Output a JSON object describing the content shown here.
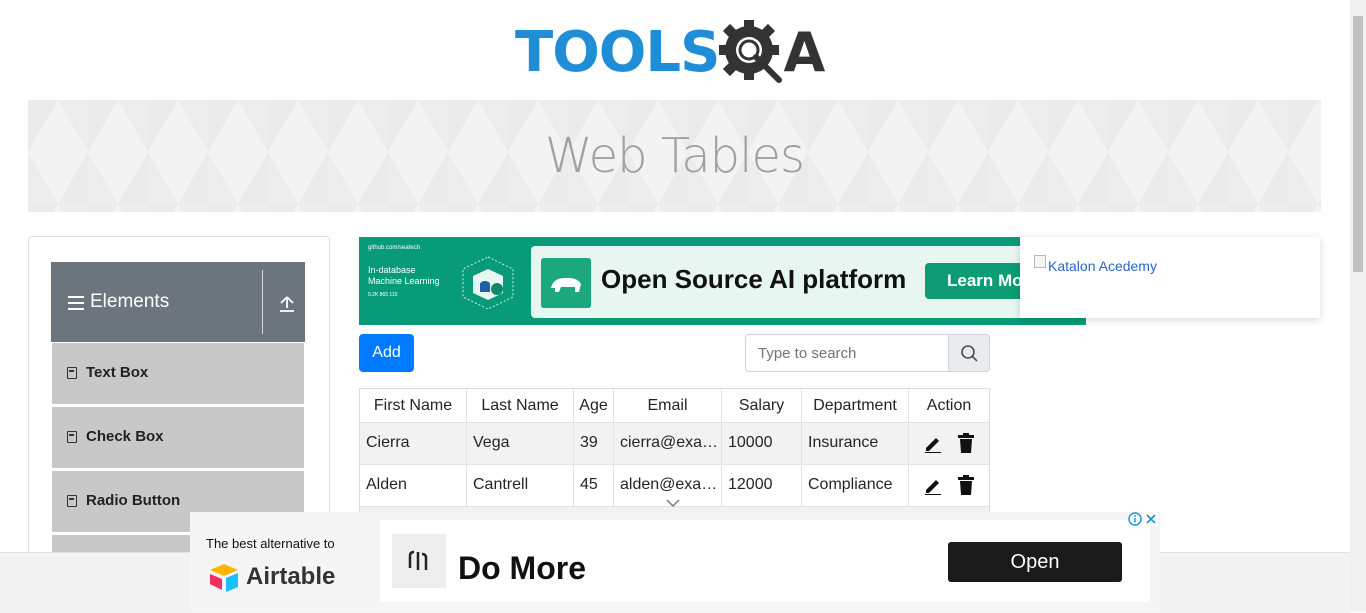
{
  "logo": {
    "tools": "TOOLS",
    "a": "A"
  },
  "banner": {
    "title": "Web Tables"
  },
  "sidebar": {
    "group_title": "Elements",
    "items": [
      {
        "label": "Text Box"
      },
      {
        "label": "Check Box"
      },
      {
        "label": "Radio Button"
      }
    ]
  },
  "ad_top": {
    "small": "github.com/seatech",
    "line1": "In-database",
    "line2": "Machine Learning",
    "stats": "9.2K  865  115",
    "headline": "Open Source AI platform",
    "cta": "Learn More"
  },
  "katalon": {
    "alt": "Katalon Acedemy"
  },
  "controls": {
    "add_label": "Add",
    "search_placeholder": "Type to search"
  },
  "table": {
    "headers": [
      "First Name",
      "Last Name",
      "Age",
      "Email",
      "Salary",
      "Department",
      "Action"
    ],
    "rows": [
      {
        "first": "Cierra",
        "last": "Vega",
        "age": "39",
        "email": "cierra@example.com",
        "salary": "10000",
        "dept": "Insurance"
      },
      {
        "first": "Alden",
        "last": "Cantrell",
        "age": "45",
        "email": "alden@example.com",
        "salary": "12000",
        "dept": "Compliance"
      }
    ]
  },
  "bottom_ad": {
    "tagline": "The best alternative to",
    "brand": "Airtable",
    "headline": "Do More",
    "cta": "Open"
  },
  "colors": {
    "brand_blue": "#1f8ed6",
    "primary": "#007bff",
    "sidebar_header": "#6c757d",
    "ad_green": "#089b7a"
  }
}
